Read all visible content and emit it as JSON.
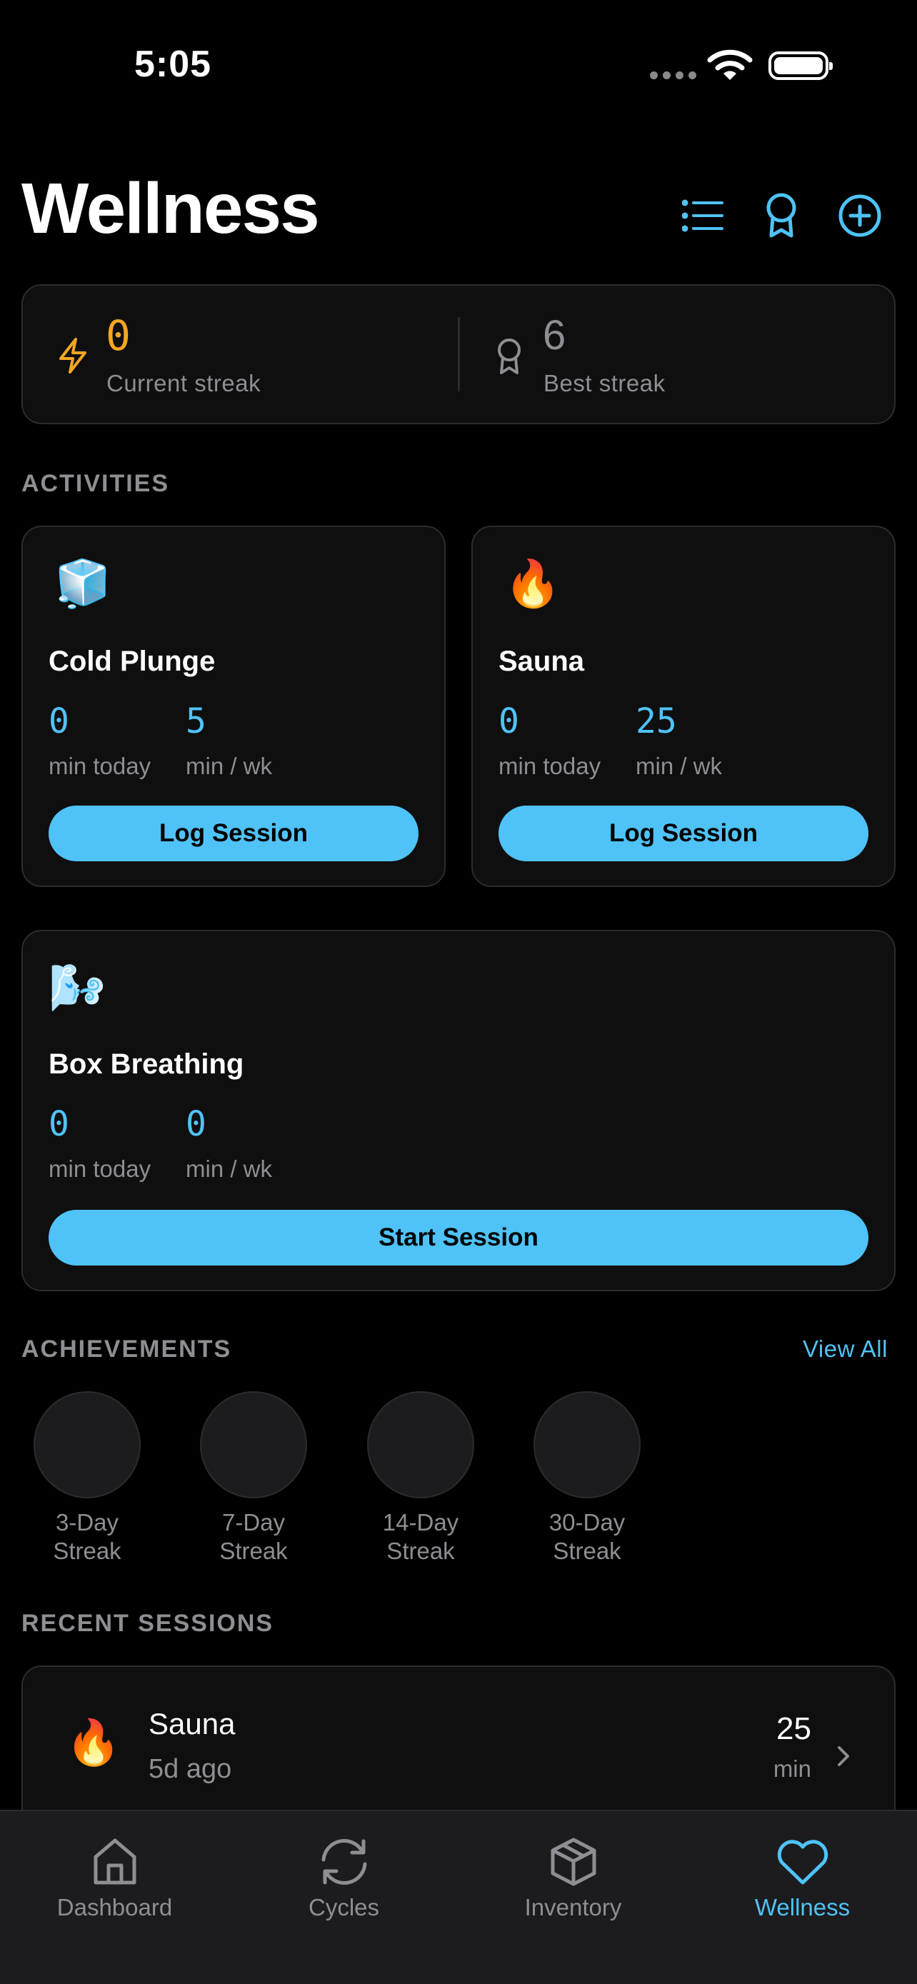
{
  "status_bar": {
    "time": "5:05"
  },
  "header": {
    "title": "Wellness",
    "icons": [
      "list-icon",
      "award-icon",
      "add-circle-icon"
    ]
  },
  "streaks": {
    "current": {
      "value": "0",
      "label": "Current streak",
      "icon": "lightning-icon",
      "color": "#f5a623"
    },
    "best": {
      "value": "6",
      "label": "Best streak",
      "icon": "award-icon"
    }
  },
  "sections": {
    "activities": "ACTIVITIES",
    "achievements": "ACHIEVEMENTS",
    "recent": "RECENT SESSIONS",
    "view_all": "View All"
  },
  "activities": [
    {
      "emoji": "🧊",
      "name": "Cold Plunge",
      "today": "0",
      "today_label": "min today",
      "week": "5",
      "week_label": "min / wk",
      "button": "Log Session"
    },
    {
      "emoji": "🔥",
      "name": "Sauna",
      "today": "0",
      "today_label": "min today",
      "week": "25",
      "week_label": "min / wk",
      "button": "Log Session"
    },
    {
      "emoji": "🌬️",
      "name": "Box Breathing",
      "today": "0",
      "today_label": "min today",
      "week": "0",
      "week_label": "min / wk",
      "button": "Start Session"
    }
  ],
  "achievements": [
    {
      "line1": "3-Day",
      "line2": "Streak"
    },
    {
      "line1": "7-Day",
      "line2": "Streak"
    },
    {
      "line1": "14-Day",
      "line2": "Streak"
    },
    {
      "line1": "30-Day",
      "line2": "Streak"
    }
  ],
  "recent_sessions": [
    {
      "emoji": "🔥",
      "name": "Sauna",
      "ago": "5d ago",
      "value": "25",
      "unit": "min"
    }
  ],
  "tabs": [
    {
      "label": "Dashboard",
      "icon": "home-icon",
      "active": false
    },
    {
      "label": "Cycles",
      "icon": "refresh-icon",
      "active": false
    },
    {
      "label": "Inventory",
      "icon": "box-icon",
      "active": false
    },
    {
      "label": "Wellness",
      "icon": "heart-icon",
      "active": true
    }
  ],
  "colors": {
    "accent": "#4fc3f7",
    "streak": "#f5a623",
    "background": "#000000",
    "card": "#0f0f10"
  }
}
